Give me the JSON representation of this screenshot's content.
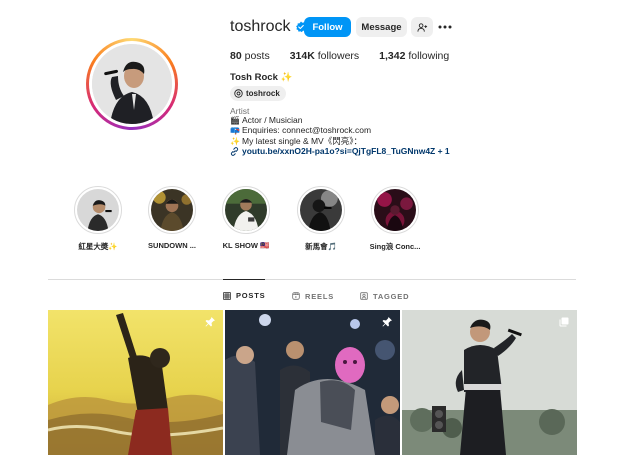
{
  "profile": {
    "username": "toshrock",
    "full_name": "Tosh Rock ✨",
    "threads_handle": "toshrock",
    "category": "Artist",
    "bio_lines": [
      {
        "emoji": "🎬",
        "text": "Actor / Musician"
      },
      {
        "emoji": "📪",
        "text": "Enquiries: connect@toshrock.com"
      },
      {
        "emoji": "✨",
        "text": "My latest single & MV《閃亮》："
      }
    ],
    "link": "youtu.be/xxnO2H-pa1o?si=QjTgFL8_TuGNnw4Z + 1",
    "link_icon": "link-icon"
  },
  "actions": {
    "follow_label": "Follow",
    "message_label": "Message",
    "suggest_icon": "add-person-icon",
    "more_icon": "more-horizontal-icon"
  },
  "stats": {
    "posts_count": "80",
    "posts_label": " posts",
    "followers_count": "314K",
    "followers_label": " followers",
    "following_count": "1,342",
    "following_label": " following"
  },
  "highlights": [
    {
      "label": "紅星大奬✨"
    },
    {
      "label": "SUNDOWN ..."
    },
    {
      "label": "KL SHOW 🇲🇾"
    },
    {
      "label": "新馬會🎵"
    },
    {
      "label": "Sing浪 Conc..."
    }
  ],
  "tabs": [
    {
      "label": "POSTS",
      "icon": "grid-icon",
      "active": true
    },
    {
      "label": "REELS",
      "icon": "reels-icon",
      "active": false
    },
    {
      "label": "TAGGED",
      "icon": "tagged-icon",
      "active": false
    }
  ],
  "posts": [
    {
      "badge": "pin-icon"
    },
    {
      "badge": "pin-icon"
    },
    {
      "badge": "carousel-icon"
    }
  ],
  "colors": {
    "accent": "#0095f6",
    "link": "#00376b",
    "secondary_text": "#737373",
    "button_gray": "#efefef"
  }
}
